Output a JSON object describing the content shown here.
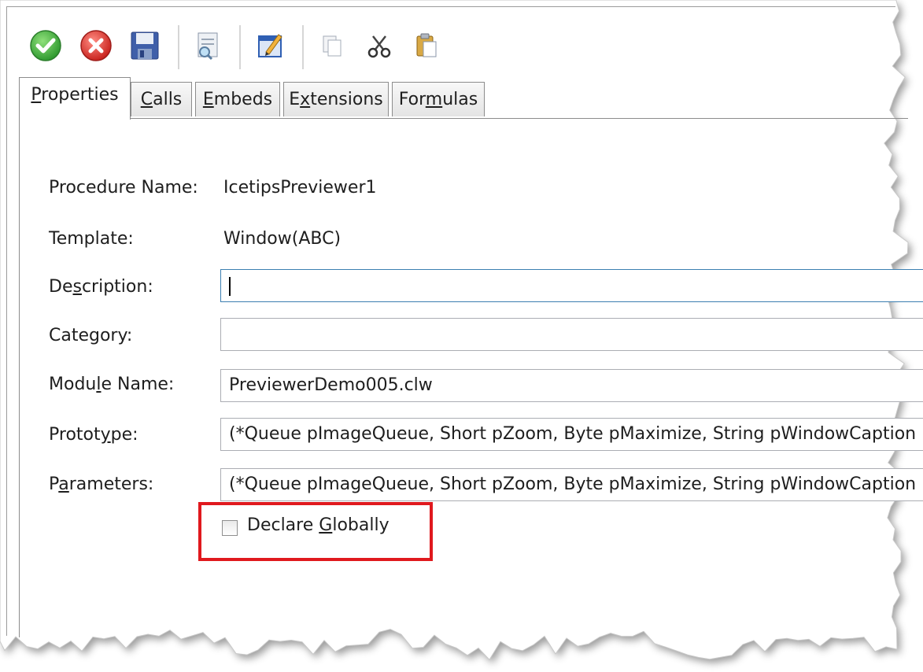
{
  "toolbar": {
    "buttons": [
      {
        "icon": "ok-check-icon",
        "color": "#3aa63a"
      },
      {
        "icon": "cancel-x-icon",
        "color": "#d9302c"
      },
      {
        "icon": "save-floppy-icon",
        "color": "#3b5ba8"
      },
      {
        "icon": "preview-document-icon",
        "color": "#7a8aa0"
      },
      {
        "icon": "edit-notepad-icon",
        "color": "#2f5fb3"
      },
      {
        "icon": "copy-icon",
        "color": "#9aa4b0"
      },
      {
        "icon": "cut-scissors-icon",
        "color": "#333333"
      },
      {
        "icon": "paste-icon",
        "color": "#c89b3a"
      }
    ]
  },
  "tabs": [
    {
      "label": "Properties",
      "underline_index": 0,
      "active": true
    },
    {
      "label": "Calls",
      "underline_index": 0,
      "active": false
    },
    {
      "label": "Embeds",
      "underline_index": 0,
      "active": false
    },
    {
      "label": "Extensions",
      "underline_index": 1,
      "active": false
    },
    {
      "label": "Formulas",
      "underline_index": 3,
      "active": false
    }
  ],
  "form": {
    "procedure_name_label": "Procedure Name:",
    "procedure_name_value": "IcetipsPreviewer1",
    "template_label": "Template:",
    "template_value": "Window(ABC)",
    "description_label": "Description:",
    "description_underline_index": 2,
    "description_value": "",
    "category_label": "Category:",
    "category_value": "",
    "module_label": "Module Name:",
    "module_underline_index": 4,
    "module_value": "PreviewerDemo005.clw",
    "prototype_label": "Prototype:",
    "prototype_underline_index": 6,
    "prototype_value": "(*Queue pImageQueue, Short pZoom, Byte pMaximize, String pWindowCaption",
    "parameters_label": "Parameters:",
    "parameters_underline_index": 1,
    "parameters_value": "(*Queue pImageQueue, Short pZoom, Byte pMaximize, String pWindowCaption",
    "declare_globally_label": "Declare Globally",
    "declare_globally_underline_index": 8,
    "declare_globally_checked": false
  },
  "annotation": {
    "highlight_color": "#e0191e"
  }
}
